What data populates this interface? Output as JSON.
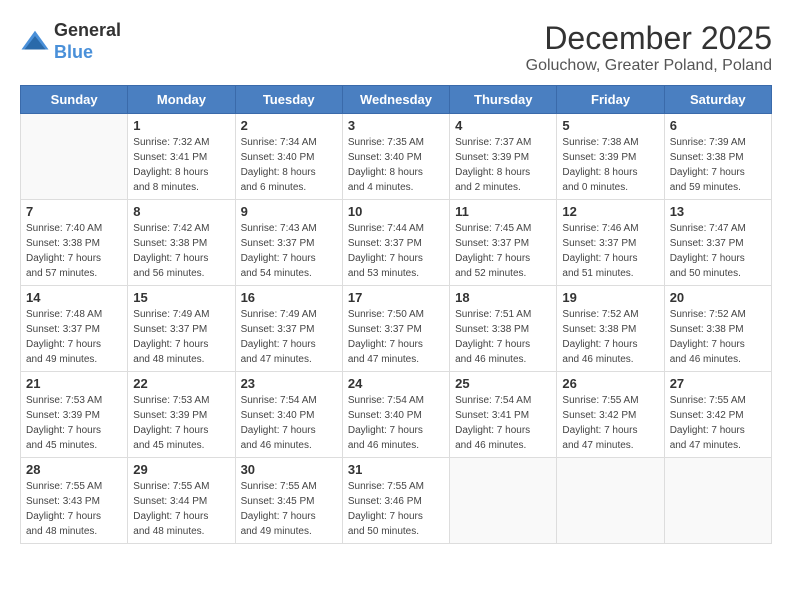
{
  "header": {
    "logo_line1": "General",
    "logo_line2": "Blue",
    "title": "December 2025",
    "subtitle": "Goluchow, Greater Poland, Poland"
  },
  "days_of_week": [
    "Sunday",
    "Monday",
    "Tuesday",
    "Wednesday",
    "Thursday",
    "Friday",
    "Saturday"
  ],
  "weeks": [
    [
      {
        "day": "",
        "info": ""
      },
      {
        "day": "1",
        "info": "Sunrise: 7:32 AM\nSunset: 3:41 PM\nDaylight: 8 hours\nand 8 minutes."
      },
      {
        "day": "2",
        "info": "Sunrise: 7:34 AM\nSunset: 3:40 PM\nDaylight: 8 hours\nand 6 minutes."
      },
      {
        "day": "3",
        "info": "Sunrise: 7:35 AM\nSunset: 3:40 PM\nDaylight: 8 hours\nand 4 minutes."
      },
      {
        "day": "4",
        "info": "Sunrise: 7:37 AM\nSunset: 3:39 PM\nDaylight: 8 hours\nand 2 minutes."
      },
      {
        "day": "5",
        "info": "Sunrise: 7:38 AM\nSunset: 3:39 PM\nDaylight: 8 hours\nand 0 minutes."
      },
      {
        "day": "6",
        "info": "Sunrise: 7:39 AM\nSunset: 3:38 PM\nDaylight: 7 hours\nand 59 minutes."
      }
    ],
    [
      {
        "day": "7",
        "info": "Sunrise: 7:40 AM\nSunset: 3:38 PM\nDaylight: 7 hours\nand 57 minutes."
      },
      {
        "day": "8",
        "info": "Sunrise: 7:42 AM\nSunset: 3:38 PM\nDaylight: 7 hours\nand 56 minutes."
      },
      {
        "day": "9",
        "info": "Sunrise: 7:43 AM\nSunset: 3:37 PM\nDaylight: 7 hours\nand 54 minutes."
      },
      {
        "day": "10",
        "info": "Sunrise: 7:44 AM\nSunset: 3:37 PM\nDaylight: 7 hours\nand 53 minutes."
      },
      {
        "day": "11",
        "info": "Sunrise: 7:45 AM\nSunset: 3:37 PM\nDaylight: 7 hours\nand 52 minutes."
      },
      {
        "day": "12",
        "info": "Sunrise: 7:46 AM\nSunset: 3:37 PM\nDaylight: 7 hours\nand 51 minutes."
      },
      {
        "day": "13",
        "info": "Sunrise: 7:47 AM\nSunset: 3:37 PM\nDaylight: 7 hours\nand 50 minutes."
      }
    ],
    [
      {
        "day": "14",
        "info": "Sunrise: 7:48 AM\nSunset: 3:37 PM\nDaylight: 7 hours\nand 49 minutes."
      },
      {
        "day": "15",
        "info": "Sunrise: 7:49 AM\nSunset: 3:37 PM\nDaylight: 7 hours\nand 48 minutes."
      },
      {
        "day": "16",
        "info": "Sunrise: 7:49 AM\nSunset: 3:37 PM\nDaylight: 7 hours\nand 47 minutes."
      },
      {
        "day": "17",
        "info": "Sunrise: 7:50 AM\nSunset: 3:37 PM\nDaylight: 7 hours\nand 47 minutes."
      },
      {
        "day": "18",
        "info": "Sunrise: 7:51 AM\nSunset: 3:38 PM\nDaylight: 7 hours\nand 46 minutes."
      },
      {
        "day": "19",
        "info": "Sunrise: 7:52 AM\nSunset: 3:38 PM\nDaylight: 7 hours\nand 46 minutes."
      },
      {
        "day": "20",
        "info": "Sunrise: 7:52 AM\nSunset: 3:38 PM\nDaylight: 7 hours\nand 46 minutes."
      }
    ],
    [
      {
        "day": "21",
        "info": "Sunrise: 7:53 AM\nSunset: 3:39 PM\nDaylight: 7 hours\nand 45 minutes."
      },
      {
        "day": "22",
        "info": "Sunrise: 7:53 AM\nSunset: 3:39 PM\nDaylight: 7 hours\nand 45 minutes."
      },
      {
        "day": "23",
        "info": "Sunrise: 7:54 AM\nSunset: 3:40 PM\nDaylight: 7 hours\nand 46 minutes."
      },
      {
        "day": "24",
        "info": "Sunrise: 7:54 AM\nSunset: 3:40 PM\nDaylight: 7 hours\nand 46 minutes."
      },
      {
        "day": "25",
        "info": "Sunrise: 7:54 AM\nSunset: 3:41 PM\nDaylight: 7 hours\nand 46 minutes."
      },
      {
        "day": "26",
        "info": "Sunrise: 7:55 AM\nSunset: 3:42 PM\nDaylight: 7 hours\nand 47 minutes."
      },
      {
        "day": "27",
        "info": "Sunrise: 7:55 AM\nSunset: 3:42 PM\nDaylight: 7 hours\nand 47 minutes."
      }
    ],
    [
      {
        "day": "28",
        "info": "Sunrise: 7:55 AM\nSunset: 3:43 PM\nDaylight: 7 hours\nand 48 minutes."
      },
      {
        "day": "29",
        "info": "Sunrise: 7:55 AM\nSunset: 3:44 PM\nDaylight: 7 hours\nand 48 minutes."
      },
      {
        "day": "30",
        "info": "Sunrise: 7:55 AM\nSunset: 3:45 PM\nDaylight: 7 hours\nand 49 minutes."
      },
      {
        "day": "31",
        "info": "Sunrise: 7:55 AM\nSunset: 3:46 PM\nDaylight: 7 hours\nand 50 minutes."
      },
      {
        "day": "",
        "info": ""
      },
      {
        "day": "",
        "info": ""
      },
      {
        "day": "",
        "info": ""
      }
    ]
  ]
}
